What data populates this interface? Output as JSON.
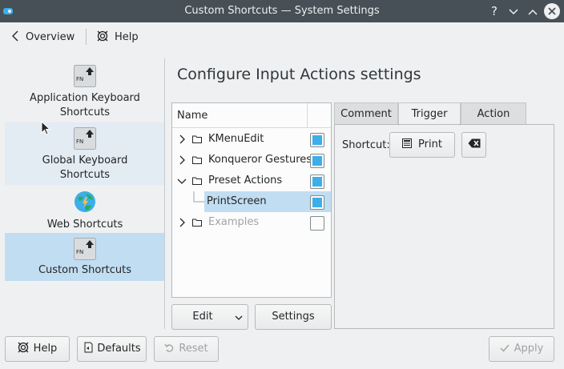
{
  "window": {
    "title": "Custom Shortcuts  — System Settings",
    "controls": [
      "?",
      "⌄",
      "⌃",
      "✕"
    ]
  },
  "toolbar": {
    "overview": "Overview",
    "help": "Help"
  },
  "sidebar": {
    "items": [
      {
        "key": "FN",
        "label1": "Application Keyboard",
        "label2": "Shortcuts"
      },
      {
        "key": "FN",
        "label1": "Global Keyboard",
        "label2": "Shortcuts"
      },
      {
        "label1": "Web Shortcuts"
      },
      {
        "key": "FN",
        "label1": "Custom Shortcuts"
      }
    ]
  },
  "main": {
    "heading": "Configure Input Actions settings"
  },
  "tree": {
    "header": "Name",
    "rows": [
      {
        "label": "KMenuEdit",
        "checked": true
      },
      {
        "label": "Konqueror Gestures",
        "checked": true
      },
      {
        "label": "Preset Actions",
        "checked": true
      },
      {
        "label": "PrintScreen",
        "checked": true
      },
      {
        "label": "Examples",
        "checked": false
      }
    ]
  },
  "tree_buttons": {
    "edit": "Edit",
    "settings": "Settings"
  },
  "tabs": [
    "Comment",
    "Trigger",
    "Action"
  ],
  "trigger": {
    "shortcut_label": "Shortcut:",
    "shortcut_value": "Print"
  },
  "footer": {
    "help": "Help",
    "defaults": "Defaults",
    "reset": "Reset",
    "apply": "Apply"
  },
  "colors": {
    "selection": "#c1ddf2",
    "accent": "#3daee9",
    "titlebar": "#475057"
  }
}
